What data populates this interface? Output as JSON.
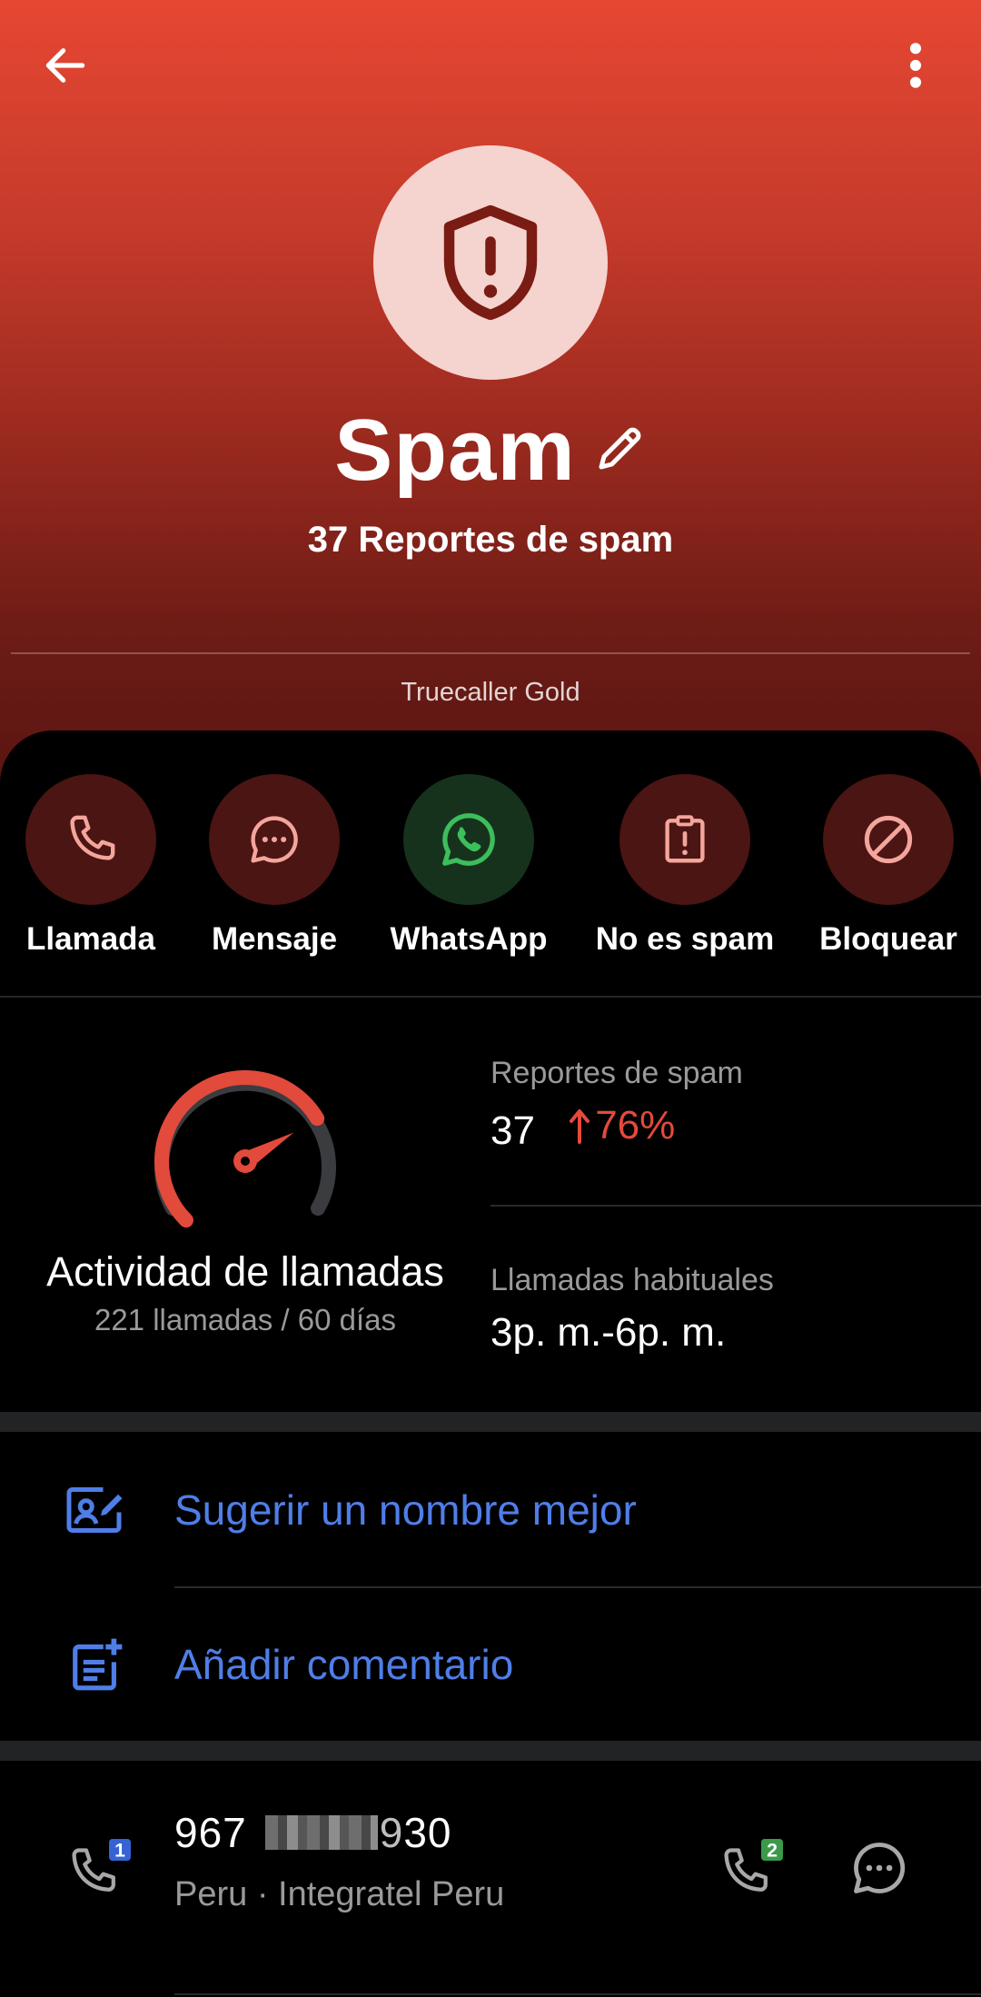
{
  "header": {
    "title": "Spam",
    "subtitle": "37 Reportes de spam",
    "badge": "Truecaller Gold",
    "back_icon": "arrow-left-icon",
    "menu_icon": "more-vertical-icon",
    "avatar_icon": "shield-alert-icon",
    "edit_icon": "pencil-icon"
  },
  "actions": [
    {
      "label": "Llamada",
      "icon": "phone-icon"
    },
    {
      "label": "Mensaje",
      "icon": "message-bubble-icon"
    },
    {
      "label": "WhatsApp",
      "icon": "whatsapp-icon"
    },
    {
      "label": "No es spam",
      "icon": "clipboard-alert-icon"
    },
    {
      "label": "Bloquear",
      "icon": "block-icon"
    }
  ],
  "activity": {
    "title": "Actividad de llamadas",
    "subtitle": "221 llamadas / 60 días",
    "gauge_level": 0.72
  },
  "stats": {
    "spam_reports_label": "Reportes de spam",
    "spam_reports_value": "37",
    "spam_reports_change": "76%",
    "usual_calls_label": "Llamadas habituales",
    "usual_calls_value": "3p. m.-6p. m."
  },
  "links": {
    "suggest_name": "Sugerir un nombre mejor",
    "add_comment": "Añadir comentario"
  },
  "phone": {
    "number_start": "967",
    "number_end": "30",
    "number_partial": "9",
    "carrier": "Peru · Integratel Peru",
    "sim1_badge": "1",
    "sim2_badge": "2"
  },
  "colors": {
    "accent_red": "#e24a3b",
    "link_blue": "#4f7ee8",
    "whatsapp_green": "#3dbd5c",
    "sim2_green": "#3a9a4a"
  }
}
